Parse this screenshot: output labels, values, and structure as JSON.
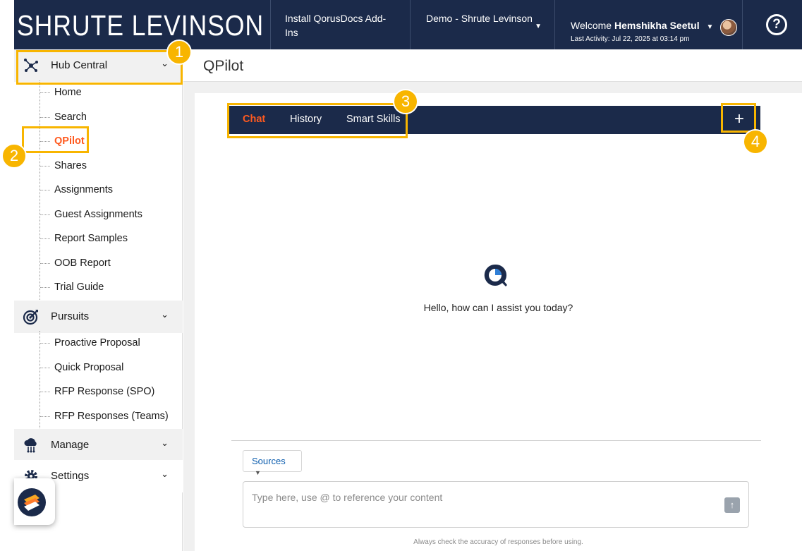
{
  "header": {
    "brand": "SHRUTE LEVINSON",
    "install_label": "Install QorusDocs Add-Ins",
    "workspace": "Demo - Shrute Levinson",
    "welcome_prefix": "Welcome",
    "user_name": "Hemshikha Seetul",
    "last_activity": "Last Activity: Jul 22, 2025 at 03:14 pm",
    "help_icon": "?"
  },
  "sidebar": {
    "sections": [
      {
        "label": "Hub Central",
        "icon": "hub-icon",
        "items": [
          "Home",
          "Search",
          "QPilot",
          "Shares",
          "Assignments",
          "Guest Assignments",
          "Report Samples",
          "OOB Report",
          "Trial Guide"
        ]
      },
      {
        "label": "Pursuits",
        "icon": "target-icon",
        "items": [
          "Proactive Proposal",
          "Quick Proposal",
          "RFP Response (SPO)",
          "RFP Responses (Teams)"
        ]
      },
      {
        "label": "Manage",
        "icon": "cloud-icon",
        "items": []
      },
      {
        "label": "Settings",
        "icon": "gear-icon",
        "items": []
      }
    ],
    "active_item": "QPilot"
  },
  "main": {
    "page_title": "QPilot",
    "tabs": [
      "Chat",
      "History",
      "Smart Skills"
    ],
    "active_tab": "Chat",
    "new_chat_symbol": "+",
    "greeting": "Hello, how can I assist you today?",
    "sources_label": "Sources",
    "input_placeholder": "Type here, use @ to reference your content",
    "disclaimer": "Always check the accuracy of responses before using."
  },
  "annotations": [
    "1",
    "2",
    "3",
    "4"
  ],
  "colors": {
    "navy": "#1b2a4a",
    "accent_orange": "#ff5a1f",
    "highlight_yellow": "#f8b500",
    "link_blue": "#0b5cad"
  }
}
